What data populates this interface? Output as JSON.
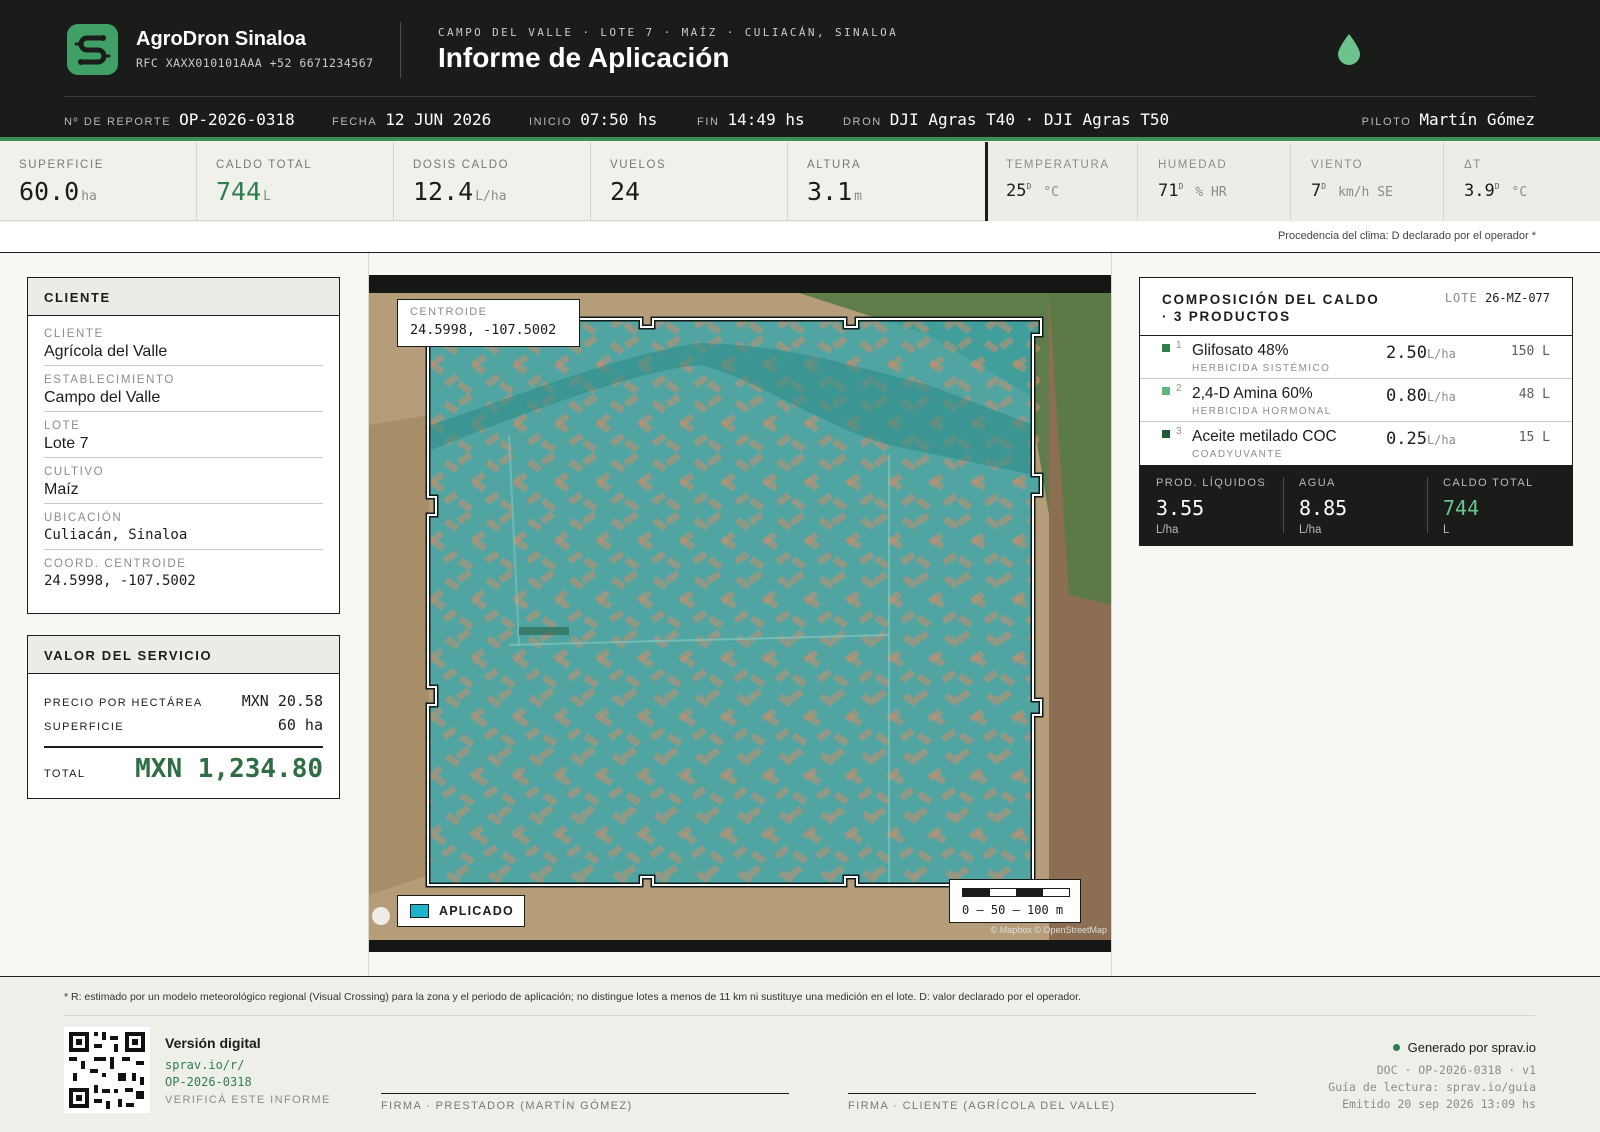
{
  "header": {
    "brand": "AgroDron Sinaloa",
    "rfc": "RFC XAXX010101AAA  +52 6671234567",
    "eyebrow": "CAMPO DEL VALLE · LOTE 7 · MAÍZ · CULIACÁN, SINALOA",
    "title": "Informe de Aplicación",
    "meta": [
      {
        "key": "Nº DE REPORTE",
        "value": "OP-2026-0318"
      },
      {
        "key": "FECHA",
        "value": "12 JUN 2026"
      },
      {
        "key": "INICIO",
        "value": "07:50 hs"
      },
      {
        "key": "FIN",
        "value": "14:49 hs"
      },
      {
        "key": "DRON",
        "value": "DJI Agras T40 · DJI Agras T50"
      },
      {
        "key": "PILOTO",
        "value": "Martín Gómez"
      }
    ]
  },
  "metrics": [
    {
      "key": "SUPERFICIE",
      "value": "60.0",
      "unit": "ha"
    },
    {
      "key": "CALDO TOTAL",
      "value": "744",
      "unit": "L"
    },
    {
      "key": "DOSIS CALDO",
      "value": "12.4",
      "unit": "L/ha"
    },
    {
      "key": "VUELOS",
      "value": "24",
      "unit": ""
    },
    {
      "key": "ALTURA",
      "value": "3.1",
      "unit": "m"
    }
  ],
  "climate": [
    {
      "key": "TEMPERATURA",
      "value": "25",
      "flag": "D",
      "unit": "°C"
    },
    {
      "key": "HUMEDAD",
      "value": "71",
      "flag": "D",
      "unit": "% HR"
    },
    {
      "key": "VIENTO",
      "value": "7",
      "flag": "D",
      "unit": "km/h SE"
    },
    {
      "key": "ΔT",
      "value": "3.9",
      "flag": "D",
      "unit": "°C"
    }
  ],
  "climate_note": "Procedencia del clima: D declarado por el operador *",
  "client_card": {
    "title": "CLIENTE",
    "fields": [
      {
        "key": "CLIENTE",
        "value": "Agrícola del Valle"
      },
      {
        "key": "ESTABLECIMIENTO",
        "value": "Campo del Valle"
      },
      {
        "key": "LOTE",
        "value": "Lote 7"
      },
      {
        "key": "CULTIVO",
        "value": "Maíz"
      },
      {
        "key": "UBICACIÓN",
        "value": "Culiacán, Sinaloa"
      },
      {
        "key": "COORD. CENTROIDE",
        "value": "24.5998, -107.5002"
      }
    ]
  },
  "service_card": {
    "title": "VALOR DEL SERVICIO",
    "price_label": "PRECIO POR HECTÁREA",
    "price_value": "MXN 20.58",
    "area_label": "SUPERFICIE",
    "area_value": "60 ha",
    "total_label": "TOTAL",
    "total_value": "MXN 1,234.80"
  },
  "map": {
    "centroid_label": "CENTROIDE",
    "centroid_value": "24.5998, -107.5002",
    "legend_label": "APLICADO",
    "scale_label": "0 — 50 — 100 m",
    "attribution": "© Mapbox © OpenStreetMap",
    "colors": {
      "applied": "#2fb3c4",
      "legend_swatch": "#1fb3cc"
    }
  },
  "composition": {
    "title_line1": "COMPOSICIÓN DEL CALDO",
    "title_line2": "· 3 PRODUCTOS",
    "lot_label": "LOTE",
    "lot_value": "26-MZ-077",
    "products": [
      {
        "n": "1",
        "name": "Glifosato 48%",
        "category": "HERBICIDA SISTÉMICO",
        "dose": "2.50",
        "dose_unit": "L/ha",
        "total": "150 L",
        "color": "#2f7d4c"
      },
      {
        "n": "2",
        "name": "2,4-D Amina 60%",
        "category": "HERBICIDA HORMONAL",
        "dose": "0.80",
        "dose_unit": "L/ha",
        "total": "48 L",
        "color": "#5cb87c"
      },
      {
        "n": "3",
        "name": "Aceite metilado COC",
        "category": "COADYUVANTE",
        "dose": "0.25",
        "dose_unit": "L/ha",
        "total": "15 L",
        "color": "#1f5a38"
      }
    ],
    "summary": [
      {
        "key": "PROD. LÍQUIDOS",
        "value": "3.55",
        "unit": "L/ha"
      },
      {
        "key": "AGUA",
        "value": "8.85",
        "unit": "L/ha"
      },
      {
        "key": "CALDO TOTAL",
        "value": "744",
        "unit": "L"
      }
    ]
  },
  "footer": {
    "note": "* R: estimado por un modelo meteorológico regional (Visual Crossing) para la zona y el periodo de aplicación; no distingue lotes a menos de 11 km ni sustituye una medición en el lote. D: valor declarado por el operador.",
    "digital_title": "Versión digital",
    "digital_link1": "sprav.io/r/",
    "digital_link2": "OP-2026-0318",
    "verify": "VERIFICÁ ESTE INFORME",
    "sig_provider": "FIRMA · PRESTADOR (MARTÍN GÓMEZ)",
    "sig_client": "FIRMA · CLIENTE (AGRÍCOLA DEL VALLE)",
    "generated": "Generado por sprav.io",
    "doc": "DOC · OP-2026-0318 · v1",
    "guide": "Guía de lectura: sprav.io/guia",
    "issued": "Emitido 20 sep 2026 13:09 hs"
  }
}
